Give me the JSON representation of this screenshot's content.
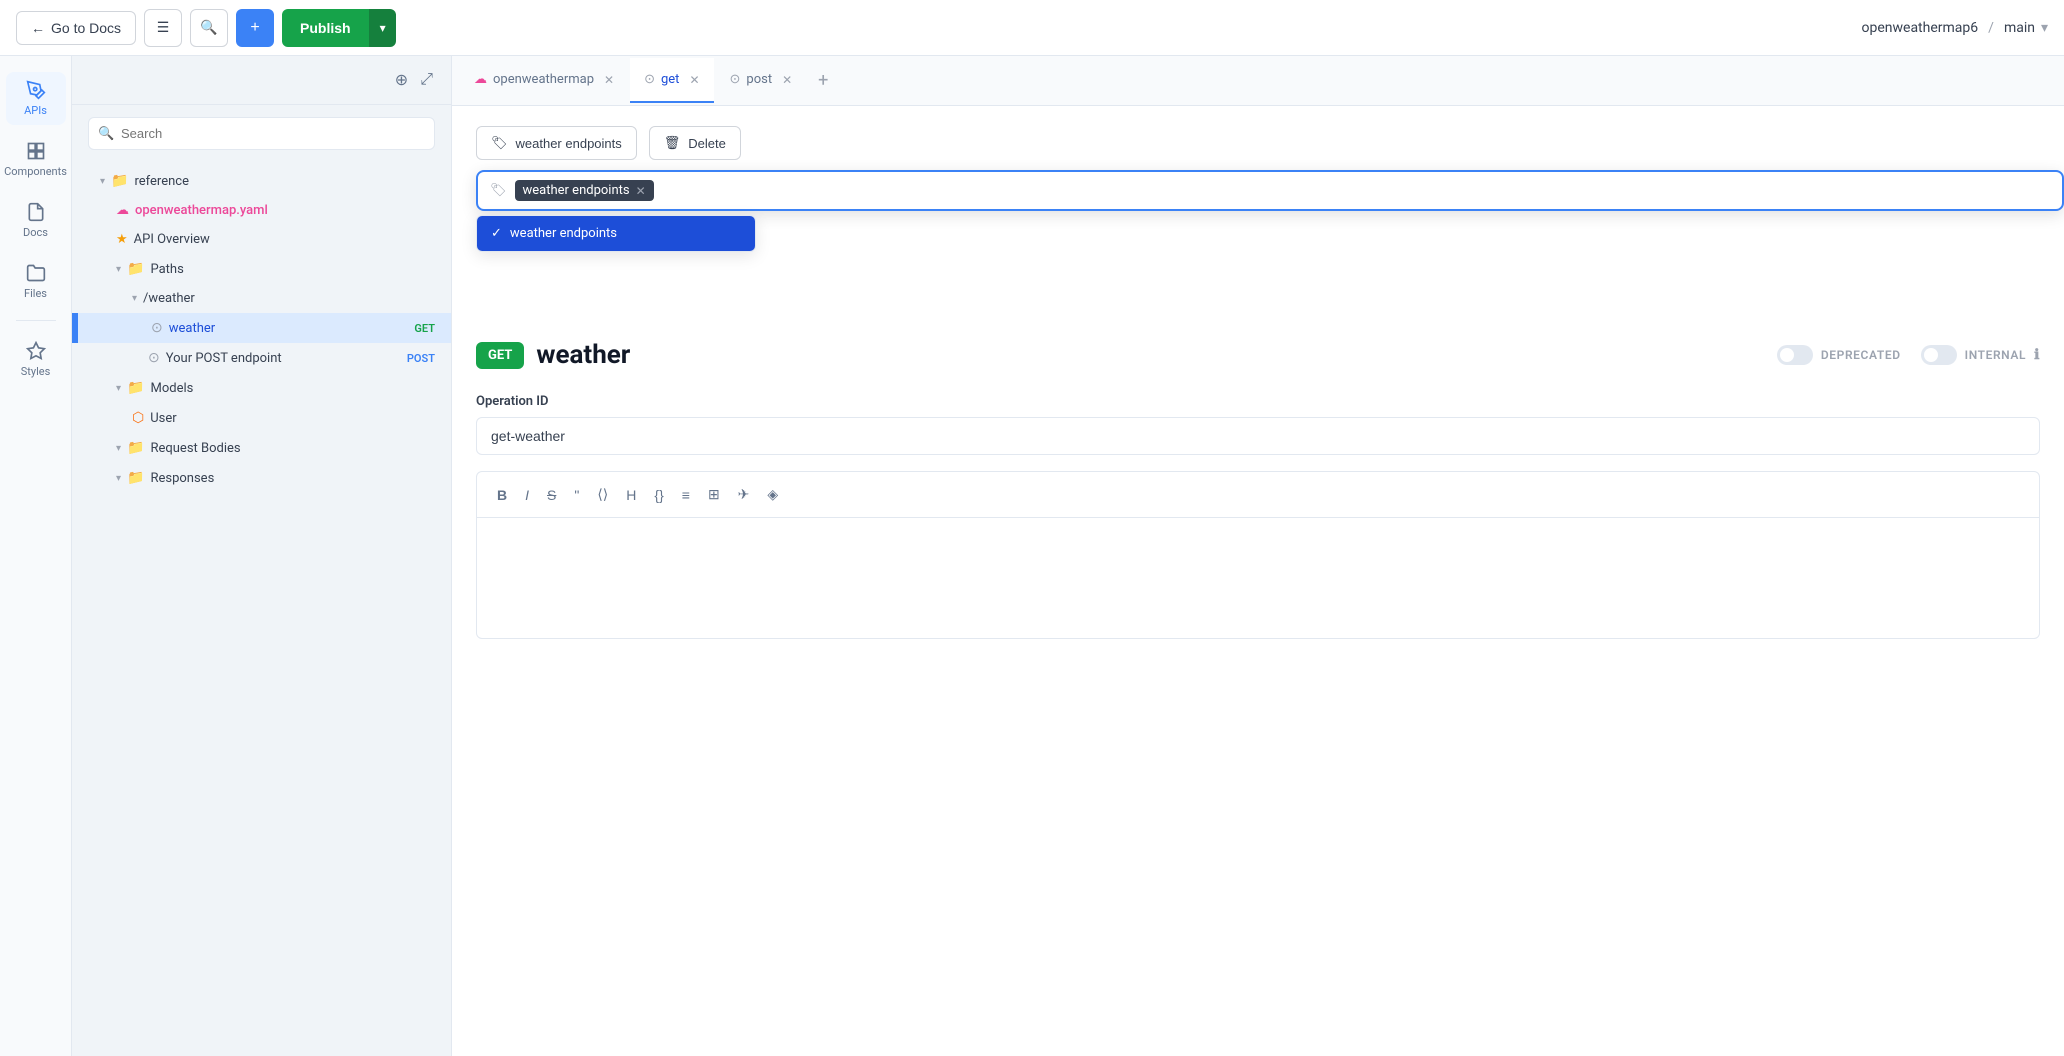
{
  "topbar": {
    "go_to_docs": "Go to Docs",
    "publish": "Publish",
    "project": "openweathermap6",
    "branch": "main"
  },
  "sidebar_icons": [
    {
      "id": "apis",
      "label": "APIs",
      "active": true
    },
    {
      "id": "components",
      "label": "Components",
      "active": false
    },
    {
      "id": "docs",
      "label": "Docs",
      "active": false
    },
    {
      "id": "files",
      "label": "Files",
      "active": false
    },
    {
      "id": "styles",
      "label": "Styles",
      "active": false
    }
  ],
  "file_tree": {
    "search_placeholder": "Search",
    "root_label": "reference",
    "file_label": "openweathermap.yaml",
    "api_overview": "API Overview",
    "paths_label": "Paths",
    "weather_path": "/weather",
    "weather_endpoint": "weather",
    "weather_method": "GET",
    "post_endpoint": "Your POST endpoint",
    "post_method": "POST",
    "models_label": "Models",
    "user_model": "User",
    "request_bodies_label": "Request Bodies",
    "responses_label": "Responses"
  },
  "tabs": [
    {
      "id": "openweathermap",
      "label": "openweathermap",
      "active": false,
      "closable": true
    },
    {
      "id": "get",
      "label": "get",
      "active": true,
      "closable": true
    },
    {
      "id": "post",
      "label": "post",
      "active": false,
      "closable": true
    }
  ],
  "content": {
    "tag_button_label": "weather endpoints",
    "delete_button_label": "Delete",
    "dropdown_tag": "weather endpoints",
    "dropdown_option": "weather endpoints",
    "get_badge": "GET",
    "endpoint_name": "weather",
    "deprecated_label": "DEPRECATED",
    "internal_label": "INTERNAL",
    "operation_id_label": "Operation ID",
    "operation_id_value": "get-weather",
    "toolbar_buttons": [
      "B",
      "I",
      "S",
      "❝",
      "⚇",
      "H",
      "{}",
      "☰",
      "⊞",
      "✈",
      "◈"
    ]
  }
}
